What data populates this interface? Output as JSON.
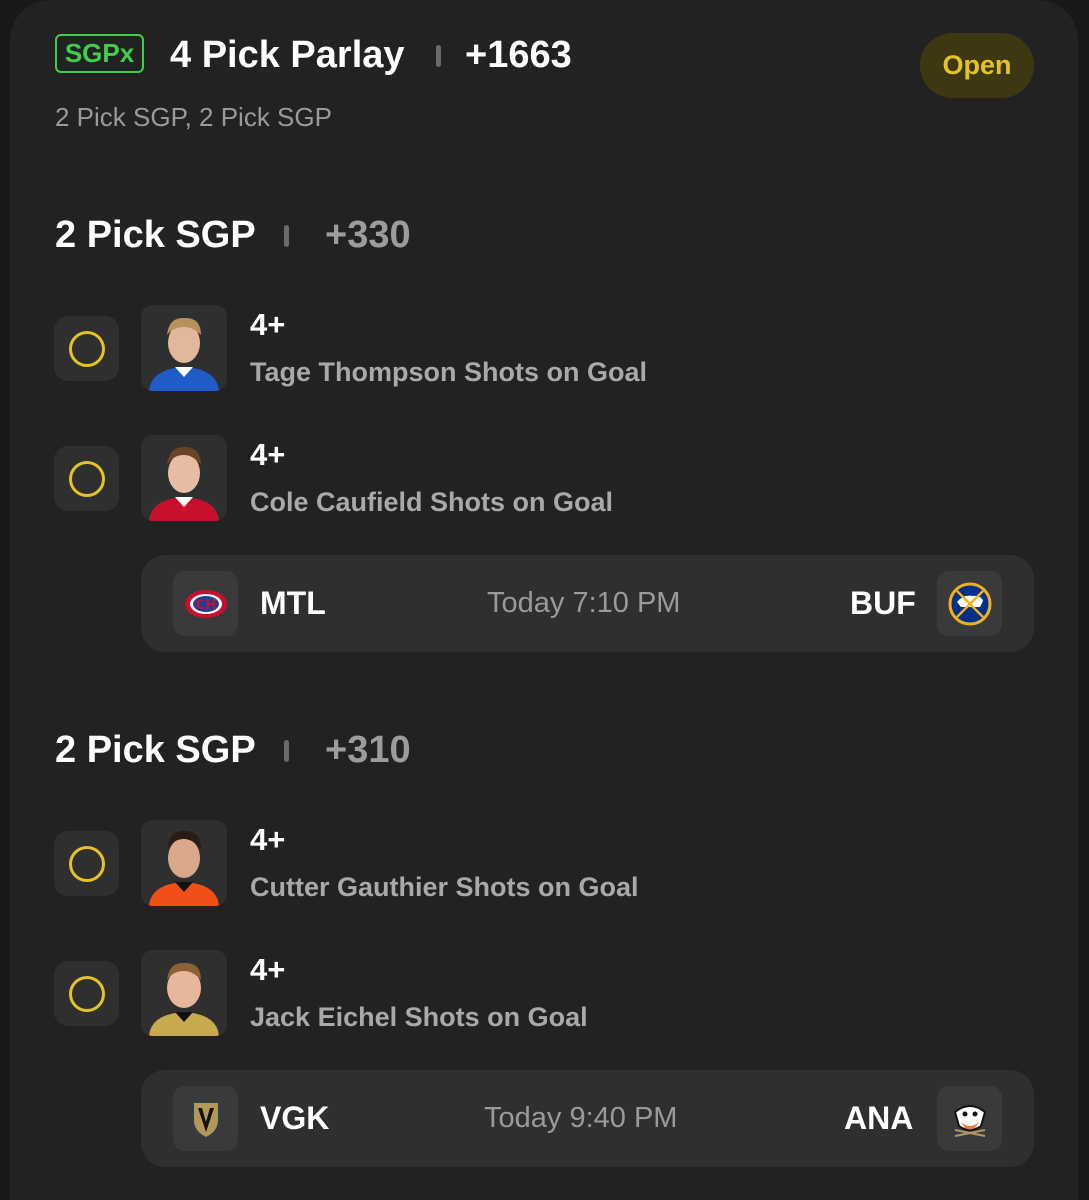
{
  "header": {
    "badge": "SGPx",
    "title": "4 Pick Parlay",
    "odds": "+1663",
    "status": "Open",
    "subtitle": "2 Pick SGP, 2 Pick SGP"
  },
  "groups": [
    {
      "title": "2 Pick SGP",
      "odds": "+330",
      "picks": [
        {
          "value": "4+",
          "desc": "Tage Thompson Shots on Goal",
          "jersey_color": "#1f5cc7"
        },
        {
          "value": "4+",
          "desc": "Cole Caufield Shots on Goal",
          "jersey_color": "#c8102e"
        }
      ],
      "game": {
        "away": "MTL",
        "home": "BUF",
        "time": "Today 7:10 PM",
        "away_logo": "canadiens-logo-icon",
        "home_logo": "sabres-logo-icon"
      }
    },
    {
      "title": "2 Pick SGP",
      "odds": "+310",
      "picks": [
        {
          "value": "4+",
          "desc": "Cutter Gauthier Shots on Goal",
          "jersey_color": "#f24f16"
        },
        {
          "value": "4+",
          "desc": "Jack Eichel Shots on Goal",
          "jersey_color": "#c9a94f"
        }
      ],
      "game": {
        "away": "VGK",
        "home": "ANA",
        "time": "Today 9:40 PM",
        "away_logo": "golden-knights-logo-icon",
        "home_logo": "ducks-logo-icon"
      }
    }
  ],
  "colors": {
    "accent_yellow": "#e4c325",
    "badge_green": "#3fcf4a",
    "card_bg": "#222222",
    "chip_bg": "#2f2f2f"
  }
}
